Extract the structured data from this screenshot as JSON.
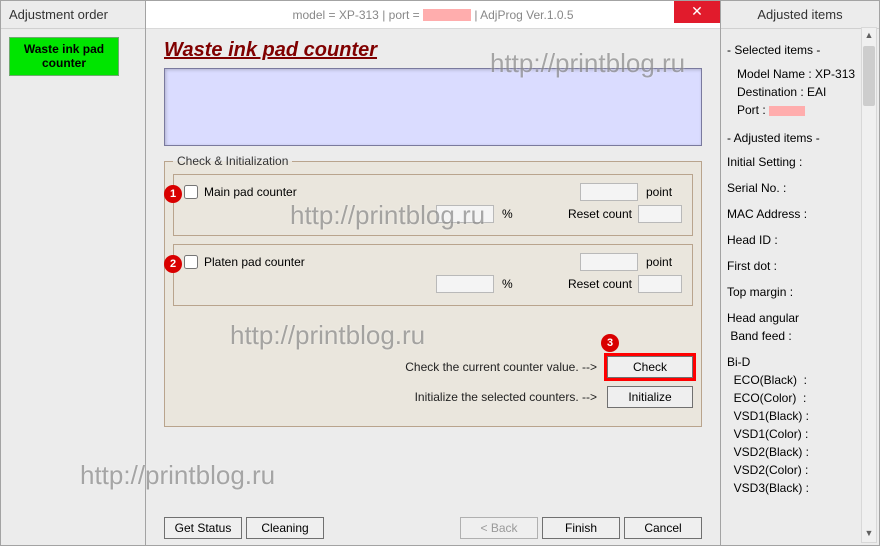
{
  "left": {
    "title": "Adjustment order",
    "waste_btn": "Waste ink pad counter"
  },
  "titlebar": {
    "model_prefix": "model = ",
    "model": "XP-313",
    "port_prefix": " | port = ",
    "suffix": " | AdjProg Ver.1.0.5",
    "close": "✕"
  },
  "main": {
    "heading": "Waste ink pad counter",
    "group_legend": "Check & Initialization",
    "badge1": "1",
    "badge2": "2",
    "badge3": "3",
    "main_pad": "Main pad counter",
    "platen_pad": "Platen pad counter",
    "point": "point",
    "percent": "%",
    "reset_count": "Reset count",
    "check_label": "Check the current counter value. -->",
    "init_label": "Initialize the selected counters. -->",
    "check_btn": "Check",
    "init_btn": "Initialize"
  },
  "bottom": {
    "get_status": "Get Status",
    "cleaning": "Cleaning",
    "back": "< Back",
    "finish": "Finish",
    "cancel": "Cancel"
  },
  "right": {
    "title": "Adjusted items",
    "selected_hdr": "- Selected items -",
    "model_name": "Model Name : XP-313",
    "destination": "Destination : EAI",
    "port": "Port : ",
    "adjusted_hdr": "- Adjusted items -",
    "items": [
      "Initial Setting :",
      "Serial No. :",
      "MAC Address :",
      "Head ID :",
      "First dot :",
      "Top margin :",
      "Head angular",
      " Band feed :",
      "Bi-D",
      "  ECO(Black)  :",
      "  ECO(Color)  :",
      "  VSD1(Black) :",
      "  VSD1(Color) :",
      "  VSD2(Black) :",
      "  VSD2(Color) :",
      "  VSD3(Black) :"
    ]
  },
  "watermark": "http://printblog.ru"
}
